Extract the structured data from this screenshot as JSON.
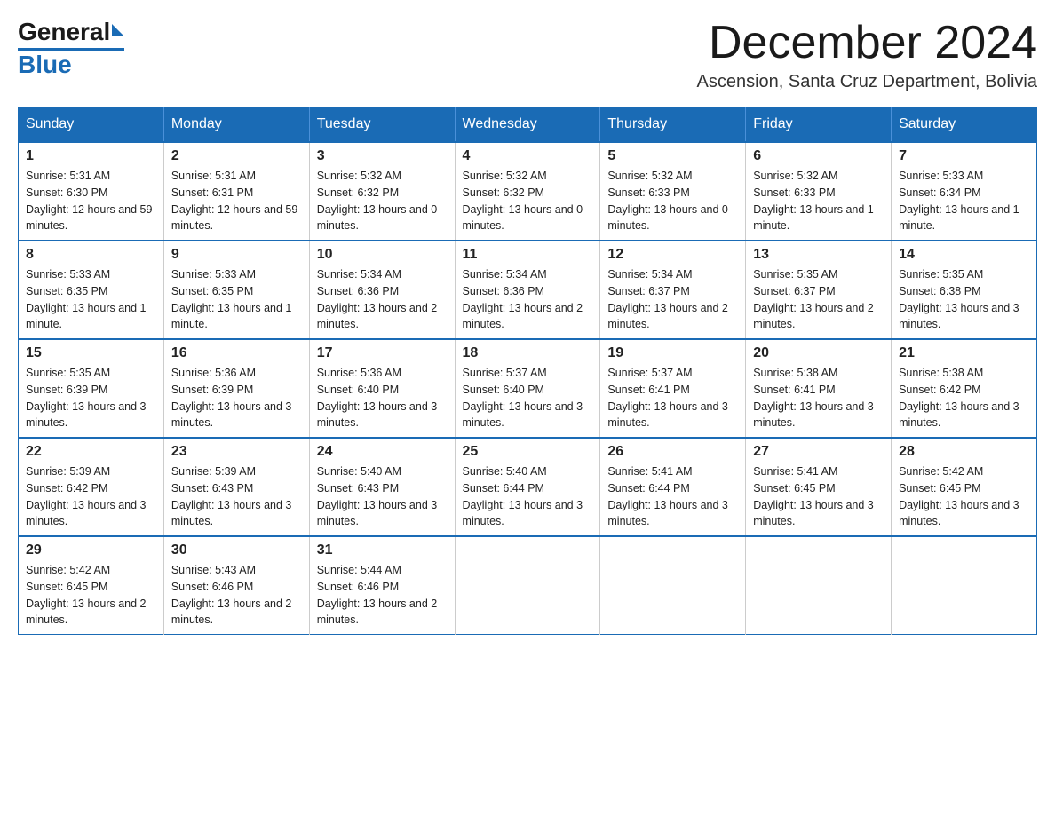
{
  "logo": {
    "general": "General",
    "blue": "Blue"
  },
  "title": "December 2024",
  "subtitle": "Ascension, Santa Cruz Department, Bolivia",
  "days_of_week": [
    "Sunday",
    "Monday",
    "Tuesday",
    "Wednesday",
    "Thursday",
    "Friday",
    "Saturday"
  ],
  "weeks": [
    [
      {
        "day": "1",
        "sunrise": "5:31 AM",
        "sunset": "6:30 PM",
        "daylight": "12 hours and 59 minutes."
      },
      {
        "day": "2",
        "sunrise": "5:31 AM",
        "sunset": "6:31 PM",
        "daylight": "12 hours and 59 minutes."
      },
      {
        "day": "3",
        "sunrise": "5:32 AM",
        "sunset": "6:32 PM",
        "daylight": "13 hours and 0 minutes."
      },
      {
        "day": "4",
        "sunrise": "5:32 AM",
        "sunset": "6:32 PM",
        "daylight": "13 hours and 0 minutes."
      },
      {
        "day": "5",
        "sunrise": "5:32 AM",
        "sunset": "6:33 PM",
        "daylight": "13 hours and 0 minutes."
      },
      {
        "day": "6",
        "sunrise": "5:32 AM",
        "sunset": "6:33 PM",
        "daylight": "13 hours and 1 minute."
      },
      {
        "day": "7",
        "sunrise": "5:33 AM",
        "sunset": "6:34 PM",
        "daylight": "13 hours and 1 minute."
      }
    ],
    [
      {
        "day": "8",
        "sunrise": "5:33 AM",
        "sunset": "6:35 PM",
        "daylight": "13 hours and 1 minute."
      },
      {
        "day": "9",
        "sunrise": "5:33 AM",
        "sunset": "6:35 PM",
        "daylight": "13 hours and 1 minute."
      },
      {
        "day": "10",
        "sunrise": "5:34 AM",
        "sunset": "6:36 PM",
        "daylight": "13 hours and 2 minutes."
      },
      {
        "day": "11",
        "sunrise": "5:34 AM",
        "sunset": "6:36 PM",
        "daylight": "13 hours and 2 minutes."
      },
      {
        "day": "12",
        "sunrise": "5:34 AM",
        "sunset": "6:37 PM",
        "daylight": "13 hours and 2 minutes."
      },
      {
        "day": "13",
        "sunrise": "5:35 AM",
        "sunset": "6:37 PM",
        "daylight": "13 hours and 2 minutes."
      },
      {
        "day": "14",
        "sunrise": "5:35 AM",
        "sunset": "6:38 PM",
        "daylight": "13 hours and 3 minutes."
      }
    ],
    [
      {
        "day": "15",
        "sunrise": "5:35 AM",
        "sunset": "6:39 PM",
        "daylight": "13 hours and 3 minutes."
      },
      {
        "day": "16",
        "sunrise": "5:36 AM",
        "sunset": "6:39 PM",
        "daylight": "13 hours and 3 minutes."
      },
      {
        "day": "17",
        "sunrise": "5:36 AM",
        "sunset": "6:40 PM",
        "daylight": "13 hours and 3 minutes."
      },
      {
        "day": "18",
        "sunrise": "5:37 AM",
        "sunset": "6:40 PM",
        "daylight": "13 hours and 3 minutes."
      },
      {
        "day": "19",
        "sunrise": "5:37 AM",
        "sunset": "6:41 PM",
        "daylight": "13 hours and 3 minutes."
      },
      {
        "day": "20",
        "sunrise": "5:38 AM",
        "sunset": "6:41 PM",
        "daylight": "13 hours and 3 minutes."
      },
      {
        "day": "21",
        "sunrise": "5:38 AM",
        "sunset": "6:42 PM",
        "daylight": "13 hours and 3 minutes."
      }
    ],
    [
      {
        "day": "22",
        "sunrise": "5:39 AM",
        "sunset": "6:42 PM",
        "daylight": "13 hours and 3 minutes."
      },
      {
        "day": "23",
        "sunrise": "5:39 AM",
        "sunset": "6:43 PM",
        "daylight": "13 hours and 3 minutes."
      },
      {
        "day": "24",
        "sunrise": "5:40 AM",
        "sunset": "6:43 PM",
        "daylight": "13 hours and 3 minutes."
      },
      {
        "day": "25",
        "sunrise": "5:40 AM",
        "sunset": "6:44 PM",
        "daylight": "13 hours and 3 minutes."
      },
      {
        "day": "26",
        "sunrise": "5:41 AM",
        "sunset": "6:44 PM",
        "daylight": "13 hours and 3 minutes."
      },
      {
        "day": "27",
        "sunrise": "5:41 AM",
        "sunset": "6:45 PM",
        "daylight": "13 hours and 3 minutes."
      },
      {
        "day": "28",
        "sunrise": "5:42 AM",
        "sunset": "6:45 PM",
        "daylight": "13 hours and 3 minutes."
      }
    ],
    [
      {
        "day": "29",
        "sunrise": "5:42 AM",
        "sunset": "6:45 PM",
        "daylight": "13 hours and 2 minutes."
      },
      {
        "day": "30",
        "sunrise": "5:43 AM",
        "sunset": "6:46 PM",
        "daylight": "13 hours and 2 minutes."
      },
      {
        "day": "31",
        "sunrise": "5:44 AM",
        "sunset": "6:46 PM",
        "daylight": "13 hours and 2 minutes."
      },
      null,
      null,
      null,
      null
    ]
  ]
}
